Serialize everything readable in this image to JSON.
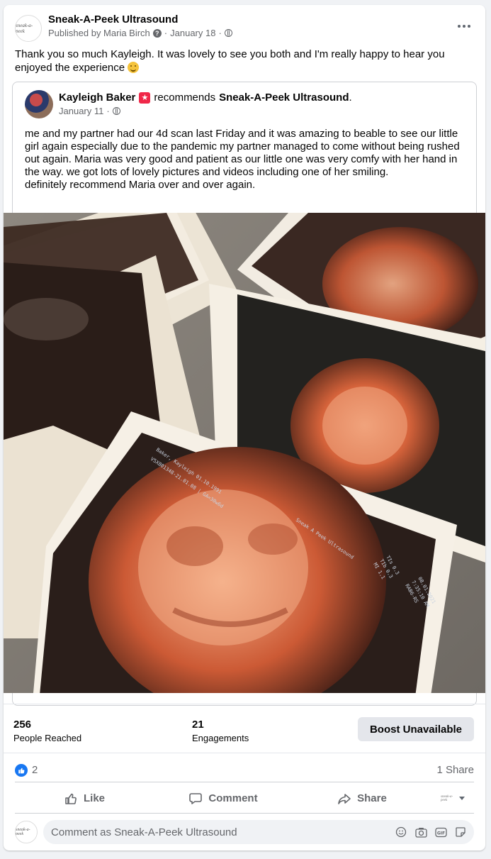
{
  "post": {
    "page_name": "Sneak-A-Peek Ultrasound",
    "avatar_text": "sneak-a-peek",
    "published_by": "Published by Maria Birch",
    "help_icon": "?",
    "dot1": "·",
    "date": "January 18",
    "dot2": "·",
    "text": "Thank you so much Kayleigh. It was lovely to see you both and I'm really happy to hear you enjoyed the experience"
  },
  "recommendation": {
    "author": "Kayleigh Baker",
    "verb": "recommends",
    "target": "Sneak-A-Peek Ultrasound",
    "period": ".",
    "date": "January 11",
    "dot": "·",
    "body": "me and my partner had our 4d scan last Friday and it was amazing to beable to see our little girl again especially due to the pandemic my partner managed to come without being rushed out again. Maria was very good and patient as our little one was very comfy with her hand in the way. we got lots of lovely pictures and videos including one of her smiling.\ndefinitely recommend Maria over and over again.",
    "photo_text": {
      "brand": "Sneak A Peek Ultrasound",
      "patient": "Baker, Kayleigh 01.10.1991",
      "scan_id": "V5X801348-21.01.08 | GA=30w6d",
      "scan_date": "08.01.2021",
      "scan_time": "7:35:10 AM",
      "probe": "RAB6-RS",
      "settings": [
        "TIs 0.3",
        "TIb 0.3",
        "MI 1.1"
      ]
    }
  },
  "stats": {
    "reached_value": "256",
    "reached_label": "People Reached",
    "engagements_value": "21",
    "engagements_label": "Engagements",
    "boost_label": "Boost Unavailable"
  },
  "reactions": {
    "like_count": "2",
    "share_count": "1 Share"
  },
  "actions": {
    "like": "Like",
    "comment": "Comment",
    "share": "Share"
  },
  "comment": {
    "placeholder": "Comment as Sneak-A-Peek Ultrasound"
  },
  "colors": {
    "accent": "#1877f2",
    "secondary_text": "#65676b",
    "recommend_badge": "#f02849"
  },
  "icons": [
    "help-icon",
    "globe-icon",
    "more-icon",
    "recommend-star-icon",
    "like-reaction-icon",
    "thumbs-up-icon",
    "comment-icon",
    "share-icon",
    "caret-down-icon",
    "emoji-icon",
    "camera-icon",
    "gif-icon",
    "sticker-icon"
  ]
}
